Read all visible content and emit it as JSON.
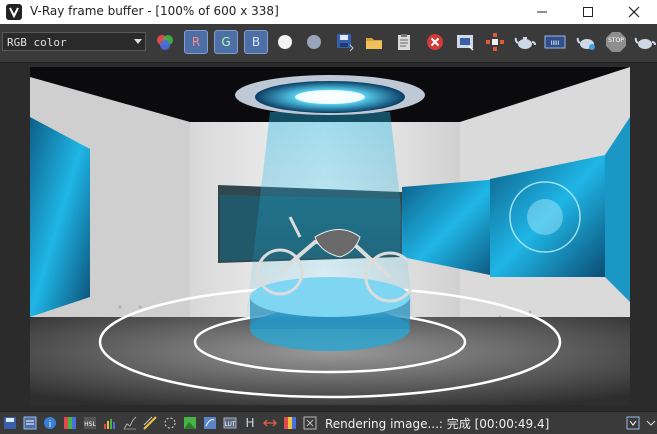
{
  "window": {
    "title": "V-Ray frame buffer - [100% of 600 x 338]",
    "controls": [
      "minimize-icon",
      "maximize-icon",
      "close-icon"
    ]
  },
  "toolbar": {
    "channel": "RGB color",
    "r_label": "R",
    "g_label": "G",
    "b_label": "B",
    "icons": [
      "color-picker-icon",
      "red-channel",
      "green-channel",
      "blue-channel",
      "white-circle-icon",
      "grey-circle-icon",
      "save-icon",
      "open-folder-icon",
      "clipboard-icon",
      "clear-icon",
      "region-icon",
      "track-mouse-icon",
      "render-teapot-icon",
      "lut-icon",
      "interactive-teapot-icon",
      "stop-icon",
      "render-icon"
    ],
    "stop_label": "STOP"
  },
  "render": {
    "scene": "motorcycle exhibition hall with holographic displays"
  },
  "status": {
    "text": "Rendering image...: 完成 [00:00:49.4]",
    "icons": [
      "save-icon",
      "history-icon",
      "info-icon",
      "color-correction-icon",
      "hsl-icon",
      "levels-icon",
      "curve-icon",
      "exposure-icon",
      "bg-image-icon",
      "lens-effects-icon",
      "lut-icon",
      "h-icon",
      "frames-icon",
      "icc-icon",
      "settings-icon"
    ],
    "h_label": "H"
  },
  "colors": {
    "accent": "#4d6fa6",
    "stop_red": "#d33b3b",
    "hologram": "#1fb6e6"
  }
}
